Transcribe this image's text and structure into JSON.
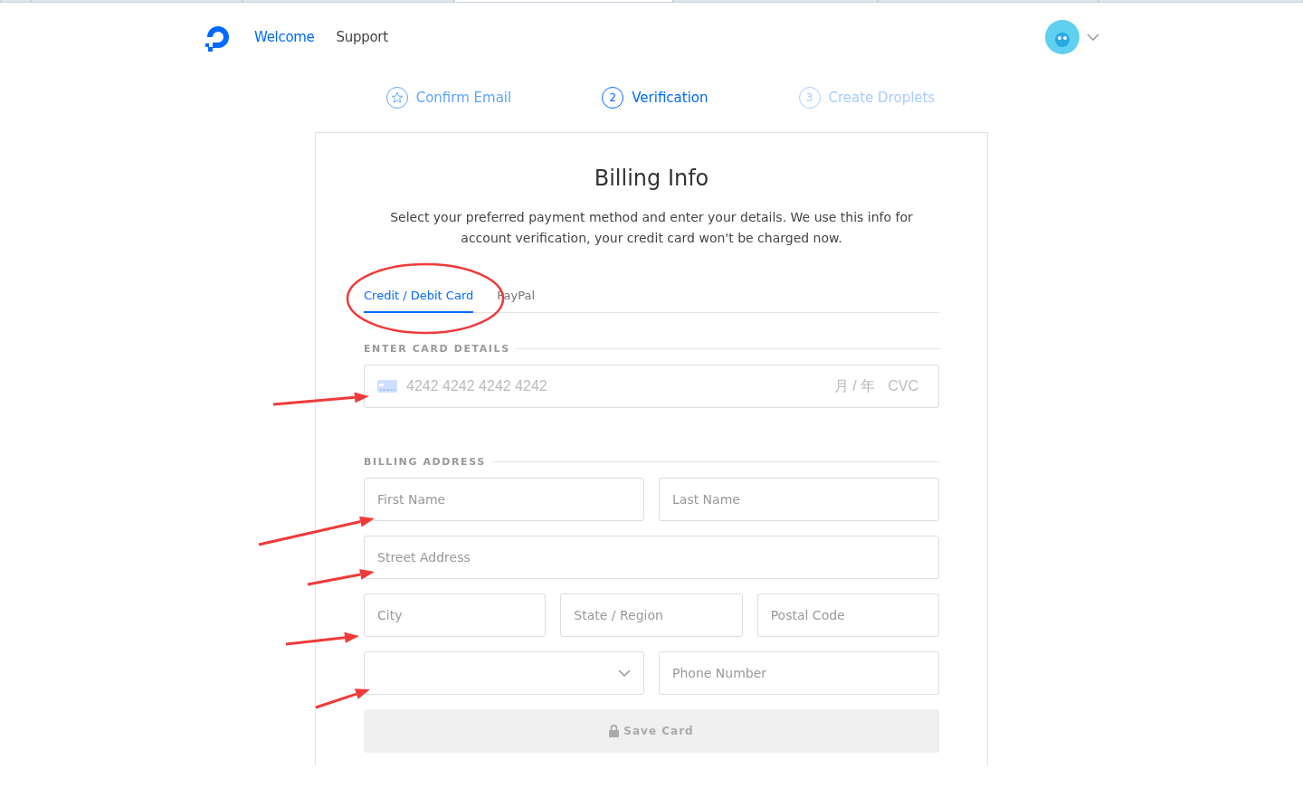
{
  "browser_tabs": [
    {
      "selected": false
    },
    {
      "selected": false
    },
    {
      "selected": false
    },
    {
      "selected": true
    },
    {
      "selected": false
    },
    {
      "selected": false
    },
    {
      "selected": false
    }
  ],
  "header": {
    "nav": [
      {
        "label": "Welcome",
        "selected": true
      },
      {
        "label": "Support",
        "selected": false
      }
    ]
  },
  "steps": [
    {
      "label": "Confirm Email",
      "completed": true,
      "selected": false
    },
    {
      "number": "2",
      "label": "Verification",
      "completed": false,
      "selected": true
    },
    {
      "number": "3",
      "label": "Create Droplets",
      "completed": false,
      "selected": false
    }
  ],
  "card": {
    "title": "Billing Info",
    "description": "Select your preferred payment method and enter your details. We use this info for account verification, your credit card won't be charged now.",
    "tabs": [
      {
        "label": "Credit / Debit Card",
        "selected": true
      },
      {
        "label": "PayPal",
        "selected": false
      }
    ],
    "card_section": {
      "heading": "ENTER CARD DETAILS",
      "number_placeholder": "4242 4242 4242 4242",
      "expiry_placeholder": "月 / 年",
      "cvc_placeholder": "CVC"
    },
    "address_section": {
      "heading": "BILLING ADDRESS",
      "rows": [
        [
          {
            "kind": "text",
            "placeholder": "First Name"
          },
          {
            "kind": "text",
            "placeholder": "Last Name"
          }
        ],
        [
          {
            "kind": "text",
            "placeholder": "Street Address"
          }
        ],
        [
          {
            "kind": "text",
            "placeholder": "City"
          },
          {
            "kind": "text",
            "placeholder": "State / Region"
          },
          {
            "kind": "text",
            "placeholder": "Postal Code"
          }
        ],
        [
          {
            "kind": "select"
          },
          {
            "kind": "text",
            "placeholder": "Phone Number"
          }
        ]
      ]
    },
    "save_button": {
      "label": "Save Card",
      "disabled": true
    }
  }
}
